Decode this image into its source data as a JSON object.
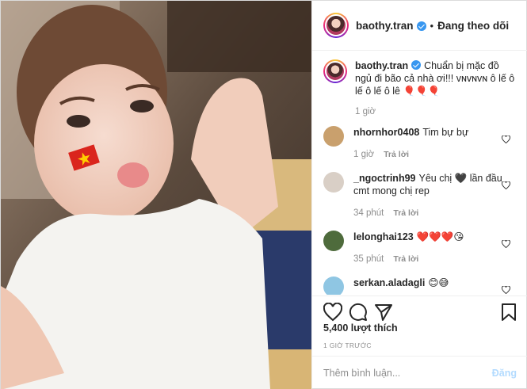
{
  "header": {
    "username": "baothy.tran",
    "separator": "•",
    "follow_label": "Đang theo dõi"
  },
  "caption": {
    "username": "baothy.tran",
    "text": "Chuẩn bị mặc đồ ngủ đi bão cả nhà ơi!!! ᴠɴᴠɴᴠɴ ô lế ô lế ô lế ô lê 🎈🎈🎈",
    "time": "1 giờ"
  },
  "comments": [
    {
      "username": "nhornhor0408",
      "text": "Tim bự bự",
      "time": "1 giờ",
      "reply": "Trả lời",
      "avatar_color": "#c9a06d"
    },
    {
      "username": "_ngoctrinh99",
      "text": "Yêu chị 🖤 lần đầu cmt mong chị rep",
      "time": "34 phút",
      "reply": "Trả lời",
      "avatar_color": "#d9cfc6"
    },
    {
      "username": "lelonghai123",
      "text": "❤️❤️❤️😘",
      "time": "35 phút",
      "reply": "Trả lời",
      "avatar_color": "#4e6b3c"
    },
    {
      "username": "serkan.aladagli",
      "text": "😊😅",
      "time": "",
      "reply": "",
      "avatar_color": "#8fc6e3"
    }
  ],
  "likes_text": "5,400 lượt thích",
  "timestamp": "1 GIỜ TRƯỚC",
  "comment_input": {
    "placeholder": "Thêm bình luận..."
  },
  "post_button": "Đăng",
  "icons": [
    "heart-icon",
    "comment-icon",
    "share-icon",
    "bookmark-icon",
    "verified-badge-icon"
  ]
}
